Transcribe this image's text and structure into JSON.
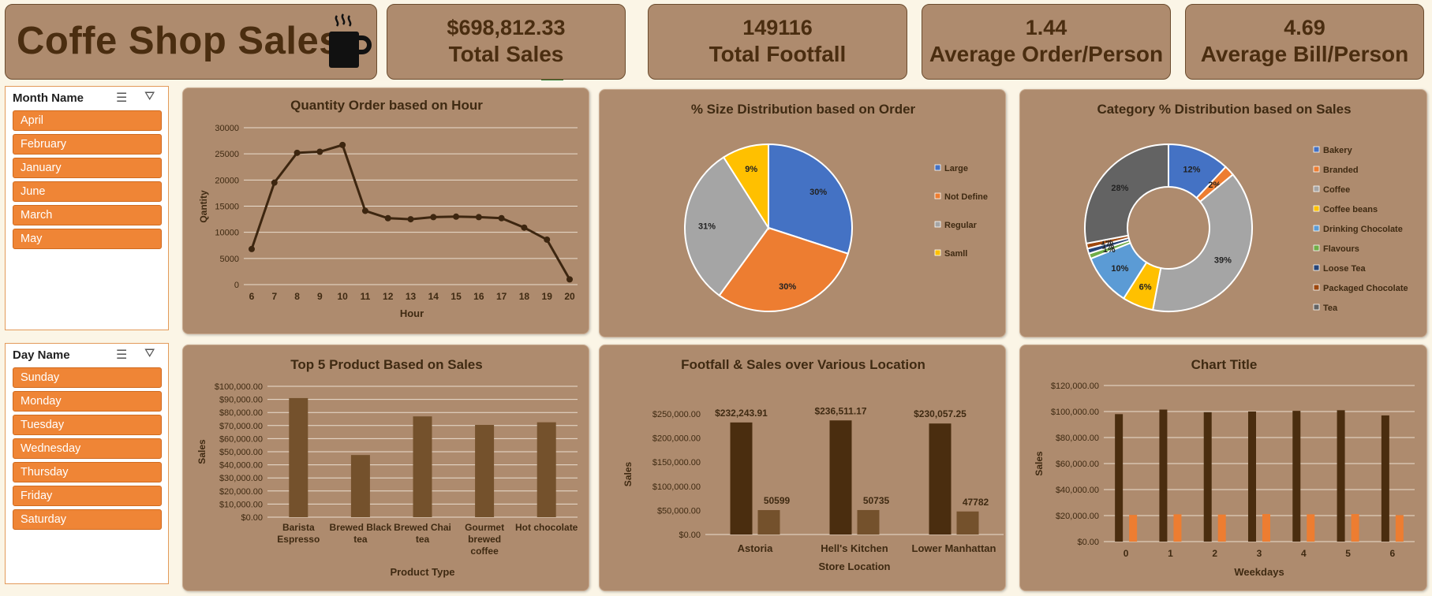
{
  "dashboard": {
    "title": "Coffe Shop Sales",
    "kpis": [
      {
        "value": "$698,812.33",
        "label": "Total Sales"
      },
      {
        "value": "149116",
        "label": "Total Footfall"
      },
      {
        "value": "1.44",
        "label": "Average Order/Person"
      },
      {
        "value": "4.69",
        "label": "Average Bill/Person"
      }
    ]
  },
  "slicers": {
    "month": {
      "title": "Month Name",
      "items": [
        "April",
        "February",
        "January",
        "June",
        "March",
        "May"
      ]
    },
    "day": {
      "title": "Day Name",
      "items": [
        "Sunday",
        "Monday",
        "Tuesday",
        "Wednesday",
        "Thursday",
        "Friday",
        "Saturday"
      ]
    }
  },
  "colors": {
    "dark_brown": "#4a2d0f",
    "mid_brown": "#74512c",
    "line": "#3d2610",
    "accent": "#ef8536"
  },
  "chart_data": [
    {
      "id": "hour",
      "type": "line",
      "title": "Quantity Order based on Hour",
      "xlabel": "Hour",
      "ylabel": "Qantity",
      "ylim": [
        0,
        30000
      ],
      "yticks": [
        "0",
        "5000",
        "10000",
        "15000",
        "20000",
        "25000",
        "30000"
      ],
      "categories": [
        "6",
        "7",
        "8",
        "9",
        "10",
        "11",
        "12",
        "13",
        "14",
        "15",
        "16",
        "17",
        "18",
        "19",
        "20"
      ],
      "values": [
        6800,
        19500,
        25200,
        25400,
        26700,
        14100,
        12700,
        12500,
        12900,
        13000,
        12900,
        12700,
        10900,
        8600,
        1000
      ],
      "grid": true
    },
    {
      "id": "size",
      "type": "pie",
      "title": "% Size Distribution based on Order",
      "slices": [
        {
          "label": "Large",
          "value": 30,
          "text": "30%",
          "color": "#4472c4"
        },
        {
          "label": "Not Define",
          "value": 30,
          "text": "30%",
          "color": "#ed7d31"
        },
        {
          "label": "Regular",
          "value": 31,
          "text": "31%",
          "color": "#a5a5a5"
        },
        {
          "label": "Samll",
          "value": 9,
          "text": "9%",
          "color": "#ffc000"
        }
      ],
      "legend": "right"
    },
    {
      "id": "category",
      "type": "pie",
      "subtype": "doughnut",
      "title": "Category % Distribution based on Sales",
      "slices": [
        {
          "label": "Bakery",
          "value": 12,
          "text": "12%",
          "color": "#4472c4"
        },
        {
          "label": "Branded",
          "value": 2,
          "text": "2%",
          "color": "#ed7d31"
        },
        {
          "label": "Coffee",
          "value": 39,
          "text": "39%",
          "color": "#a5a5a5"
        },
        {
          "label": "Coffee beans",
          "value": 6,
          "text": "6%",
          "color": "#ffc000"
        },
        {
          "label": "Drinking Chocolate",
          "value": 10,
          "text": "10%",
          "color": "#5b9bd5"
        },
        {
          "label": "Flavours",
          "value": 1,
          "text": "1%",
          "color": "#70ad47"
        },
        {
          "label": "Loose Tea",
          "value": 1,
          "text": "1%",
          "color": "#264478"
        },
        {
          "label": "Packaged Chocolate",
          "value": 1,
          "text": "1%",
          "color": "#9e480e"
        },
        {
          "label": "Tea",
          "value": 28,
          "text": "28%",
          "color": "#636363"
        }
      ],
      "legend": "right"
    },
    {
      "id": "top5",
      "type": "bar",
      "title": "Top 5 Product Based on Sales",
      "xlabel": "Product Type",
      "ylabel": "Sales",
      "ylim": [
        0,
        100000
      ],
      "yticks": [
        "$0.00",
        "$10,000.00",
        "$20,000.00",
        "$30,000.00",
        "$40,000.00",
        "$50,000.00",
        "$60,000.00",
        "$70,000.00",
        "$80,000.00",
        "$90,000.00",
        "$100,000.00"
      ],
      "categories": [
        [
          "Barista",
          "Espresso"
        ],
        [
          "Brewed Black",
          "tea"
        ],
        [
          "Brewed Chai",
          "tea"
        ],
        [
          "Gourmet",
          "brewed",
          "coffee"
        ],
        [
          "Hot chocolate"
        ]
      ],
      "values": [
        91000,
        47500,
        77000,
        70500,
        72500
      ],
      "grid": true
    },
    {
      "id": "location",
      "type": "bar",
      "title": "Footfall & Sales over Various Location",
      "xlabel": "Store Location",
      "ylabel": "Sales",
      "ylim": [
        0,
        250000
      ],
      "yticks": [
        "$0.00",
        "$50,000.00",
        "$100,000.00",
        "$150,000.00",
        "$200,000.00",
        "$250,000.00"
      ],
      "categories": [
        "Astoria",
        "Hell's Kitchen",
        "Lower Manhattan"
      ],
      "series": [
        {
          "values": [
            232243.91,
            236511.17,
            230057.25
          ],
          "labels": [
            "$232,243.91",
            "$236,511.17",
            "$230,057.25"
          ]
        },
        {
          "values": [
            50599,
            50735,
            47782
          ],
          "labels": [
            "50599",
            "50735",
            "47782"
          ]
        }
      ],
      "grid": false
    },
    {
      "id": "weekday",
      "type": "bar",
      "title": "Chart Title",
      "xlabel": "Weekdays",
      "ylabel": "Sales",
      "ylim": [
        0,
        120000
      ],
      "yticks": [
        "$0.00",
        "$20,000.00",
        "$40,000.00",
        "$60,000.00",
        "$80,000.00",
        "$100,000.00",
        "$120,000.00"
      ],
      "categories": [
        "0",
        "1",
        "2",
        "3",
        "4",
        "5",
        "6"
      ],
      "series": [
        {
          "values": [
            98000,
            101500,
            99500,
            100000,
            100500,
            101000,
            97000
          ]
        },
        {
          "values": [
            20500,
            21000,
            20800,
            21200,
            21000,
            21200,
            20300
          ]
        }
      ],
      "grid": true
    }
  ]
}
